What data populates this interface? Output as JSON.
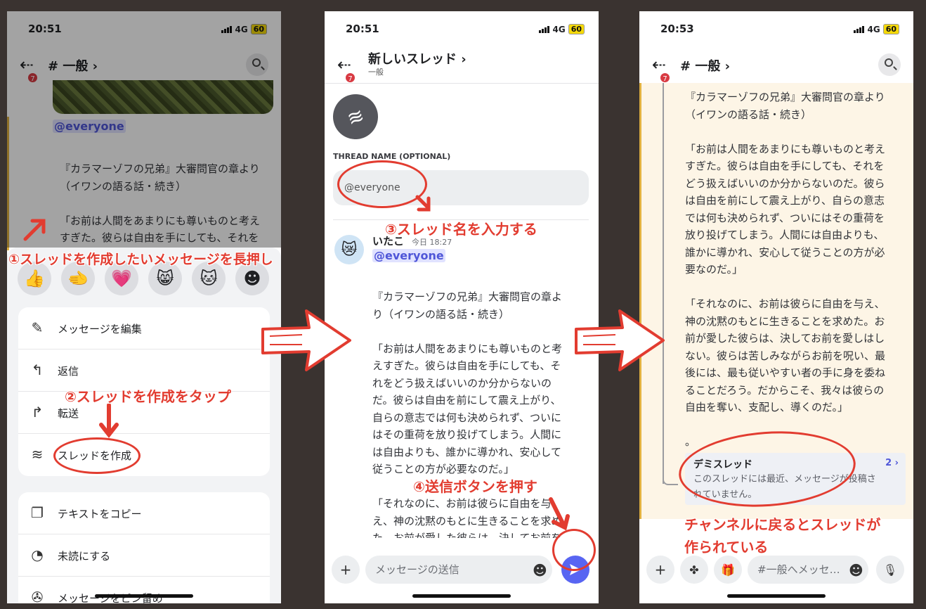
{
  "status": {
    "time1": "20:51",
    "time2": "20:51",
    "time3": "20:53",
    "network": "4G",
    "battery": "60"
  },
  "badge_count": "7",
  "panel1": {
    "channel": "# 一般 ›",
    "mention": "@everyone",
    "message": "『カラマーゾフの兄弟』大審問官の章より\n（イワンの語る話・続き）\n\n「お前は人間をあまりにも尊いものと考え\nすぎた。彼らは自由を手にしても、それを",
    "actions": [
      "メッセージを編集",
      "返信",
      "転送",
      "スレッドを作成"
    ],
    "actions2": [
      "テキストをコピー",
      "未読にする",
      "メッセージをピン留め"
    ]
  },
  "panel2": {
    "title": "新しいスレッド ›",
    "subtitle": "一般",
    "thread_name_label": "THREAD NAME (OPTIONAL)",
    "thread_name_value": "@everyone",
    "author": "いたこ",
    "timestamp": "今日 18:27",
    "mention": "@everyone",
    "message": "『カラマーゾフの兄弟』大審問官の章よ\nり（イワンの語る話・続き）\n\n「お前は人間をあまりにも尊いものと考\nえすぎた。彼らは自由を手にしても、そ\nれをどう扱えばいいのか分からないの\nだ。彼らは自由を前にして震え上がり、\n自らの意志では何も決められず、ついに\nはその重荷を放り投げてしまう。人間に\nは自由よりも、誰かに導かれ、安心して\n従うことの方が必要なのだ。」\n\n「それなのに、お前は彼らに自由を与\nえ、神の沈黙のもとに生きることを求め\nた。お前が愛した彼らは、決してお前を",
    "composer_placeholder": "メッセージの送信"
  },
  "panel3": {
    "channel": "# 一般 ›",
    "message": "『カラマーゾフの兄弟』大審問官の章より\n（イワンの語る話・続き）\n\n「お前は人間をあまりにも尊いものと考え\nすぎた。彼らは自由を手にしても、それを\nどう扱えばいいのか分からないのだ。彼ら\nは自由を前にして震え上がり、自らの意志\nでは何も決められず、ついにはその重荷を\n放り投げてしまう。人間には自由よりも、\n誰かに導かれ、安心して従うことの方が必\n要なのだ。」\n\n「それなのに、お前は彼らに自由を与え、\n神の沈黙のもとに生きることを求めた。お\n前が愛した彼らは、決してお前を愛しはし\nない。彼らは苦しみながらお前を呪い、最\n後には、最も従いやすい者の手に身を委ね\nることだろう。だからこそ、我々は彼らの\n自由を奪い、支配し、導くのだ。」\n\n。",
    "thread_name": "デミスレッド",
    "thread_count": "2 ›",
    "thread_preview": "このスレッドには最近、メッセージが投稿さ\nれていません。",
    "composer_placeholder": "#一般へメッセ…"
  },
  "annotations": {
    "step1": "①スレッドを作成したいメッセージを長押し",
    "step2": "②スレッドを作成をタップ",
    "step3": "③スレッド名を入力する",
    "step4": "④送信ボタンを押す",
    "step5a": "チャンネルに戻るとスレッドが",
    "step5b": "作られている"
  },
  "colors": {
    "annotation": "#e23c30",
    "accent": "#5865f2",
    "thread_bg": "#fdf5e6",
    "mention": "#4f56d8"
  }
}
